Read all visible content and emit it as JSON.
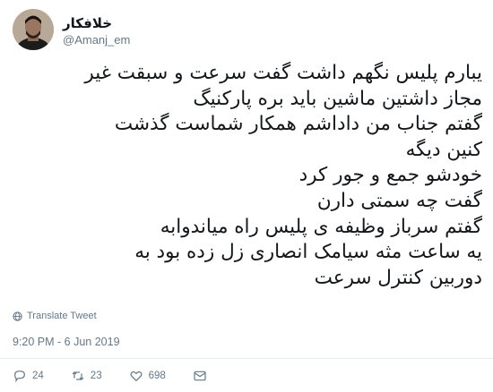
{
  "user": {
    "display_name": "خلافکار",
    "handle": "@Amanj_em"
  },
  "tweet": {
    "lines": [
      "یبارم پلیس نگهم داشت گفت سرعت و سبقت غیر",
      "مجاز داشتین ماشین باید بره پارکنیگ",
      "گفتم جناب من داداشم همکار شماست گذشت",
      "کنین دیگه",
      "خودشو جمع و جور کرد",
      "گفت چه سمتی دارن",
      "گفتم سرباز وظیفه ی پلیس راه میاندوابه",
      "یه ساعت مثه سیامک انصاری زل زده بود به",
      "دوربین کنترل سرعت"
    ],
    "translate_label": "Translate Tweet",
    "timestamp": "9:20 PM - 6 Jun 2019"
  },
  "actions": {
    "reply_count": "24",
    "retweet_count": "23",
    "like_count": "698"
  },
  "colors": {
    "text": "#14171a",
    "secondary": "#657786"
  },
  "icons": [
    "globe-icon",
    "reply-icon",
    "retweet-icon",
    "like-icon",
    "dm-icon"
  ]
}
